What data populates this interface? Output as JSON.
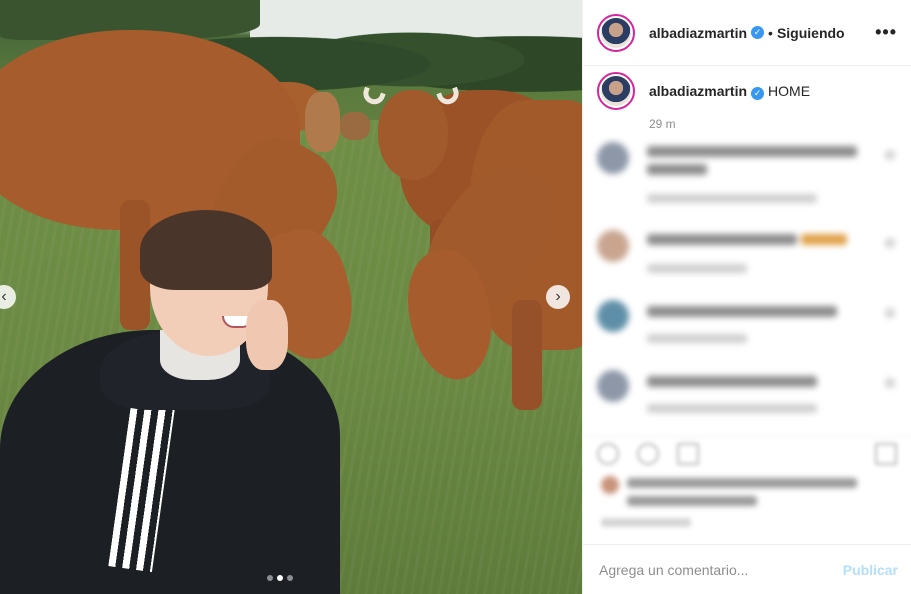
{
  "post": {
    "username": "albadiazmartin",
    "verified": true,
    "follow_status": "Siguiendo",
    "separator": "•",
    "more_icon": "more-horizontal-icon",
    "caption": "HOME",
    "time": "29 m"
  },
  "media": {
    "carousel_dots": 3,
    "active_dot": 2,
    "prev_icon": "chevron-left-icon",
    "next_icon": "chevron-right-icon"
  },
  "comment_box": {
    "placeholder": "Agrega un comentario...",
    "publish_label": "Publicar"
  },
  "colors": {
    "verified_blue": "#3897f0",
    "publish_disabled": "#b2dffc",
    "story_ring": "#d6249f"
  }
}
